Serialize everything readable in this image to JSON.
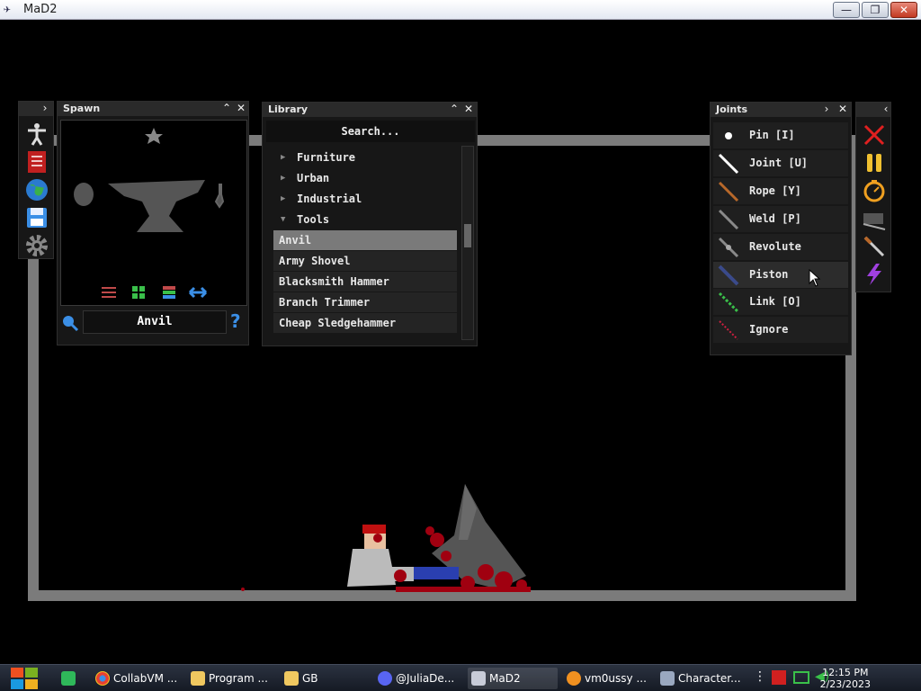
{
  "window": {
    "title": "MaD2",
    "minimize": "—",
    "maximize": "❐",
    "close": "✕"
  },
  "spawn": {
    "title": "Spawn",
    "selected_name": "Anvil",
    "help": "?"
  },
  "library": {
    "title": "Library",
    "search_placeholder": "Search...",
    "categories": [
      "Furniture",
      "Urban",
      "Industrial",
      "Tools"
    ],
    "items": [
      "Anvil",
      "Army Shovel",
      "Blacksmith Hammer",
      "Branch Trimmer",
      "Cheap Sledgehammer"
    ],
    "selected_item": "Anvil"
  },
  "joints": {
    "title": "Joints",
    "items": [
      {
        "label": "Pin [I]",
        "icon": "pin-icon",
        "color": "#ffffff"
      },
      {
        "label": "Joint [U]",
        "icon": "joint-icon",
        "color": "#ffffff"
      },
      {
        "label": "Rope [Y]",
        "icon": "rope-icon",
        "color": "#b8682a"
      },
      {
        "label": "Weld [P]",
        "icon": "weld-icon",
        "color": "#8a8a8a"
      },
      {
        "label": "Revolute",
        "icon": "revolute-icon",
        "color": "#8a8a8a"
      },
      {
        "label": "Piston",
        "icon": "piston-icon",
        "color": "#3a4a8a"
      },
      {
        "label": "Link [O]",
        "icon": "link-icon",
        "color": "#3ac04a"
      },
      {
        "label": "Ignore",
        "icon": "ignore-icon",
        "color": "#d02040"
      }
    ],
    "hovered": "Piston"
  },
  "taskbar": {
    "items": [
      {
        "label": "",
        "icon": "chat-icon"
      },
      {
        "label": "CollabVM ...",
        "icon": "chrome-icon"
      },
      {
        "label": "Program ...",
        "icon": "folder-icon"
      },
      {
        "label": "GB",
        "icon": "folder-icon"
      },
      {
        "label": "@JuliaDe...",
        "icon": "discord-icon"
      },
      {
        "label": "MaD2",
        "icon": "mad2-icon"
      },
      {
        "label": "vm0ussy ...",
        "icon": "x-icon"
      },
      {
        "label": "Character...",
        "icon": "app-icon"
      }
    ],
    "time": "12:15 PM",
    "date": "2/23/2023"
  }
}
